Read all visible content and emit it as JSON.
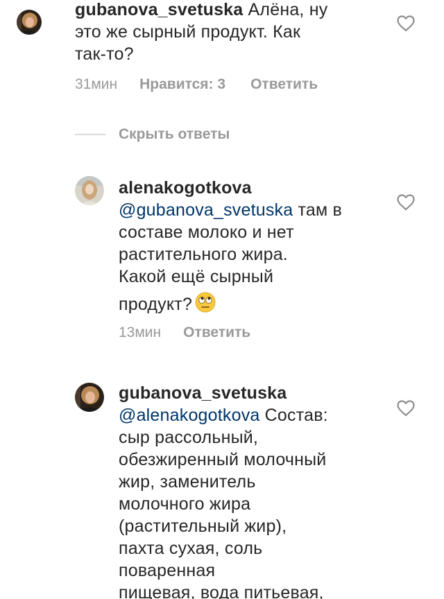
{
  "comments": [
    {
      "username": "gubanova_svetuska",
      "lines": [
        "Алёна, ну",
        "это же сырный продукт. Как",
        "так-то?"
      ],
      "time": "31мин",
      "likes": "Нравится: 3",
      "reply": "Ответить"
    },
    {
      "username": "alenakogotkova",
      "mention": "@gubanova_svetuska",
      "lines": [
        "там в",
        "составе молоко и нет",
        "растительного жира.",
        "Какой ещё сырный",
        "продукт?"
      ],
      "emoji": "face-with-rolling-eyes",
      "time": "13мин",
      "reply": "Ответить"
    },
    {
      "username": "gubanova_svetuska",
      "mention": "@alenakogotkova",
      "lines": [
        "Состав:",
        "сыр рассольный,",
        "обезжиренный молочный",
        "жир, заменитель",
        "молочного жира",
        "(растительный жир),",
        "пахта сухая, соль",
        "поваренная",
        "пищевая, вода питьевая,"
      ]
    }
  ],
  "hide_replies": "Скрыть ответы",
  "icons": {
    "like": "heart-outline-icon"
  },
  "colors": {
    "text": "#262626",
    "meta": "#999999",
    "mention": "#003569"
  }
}
